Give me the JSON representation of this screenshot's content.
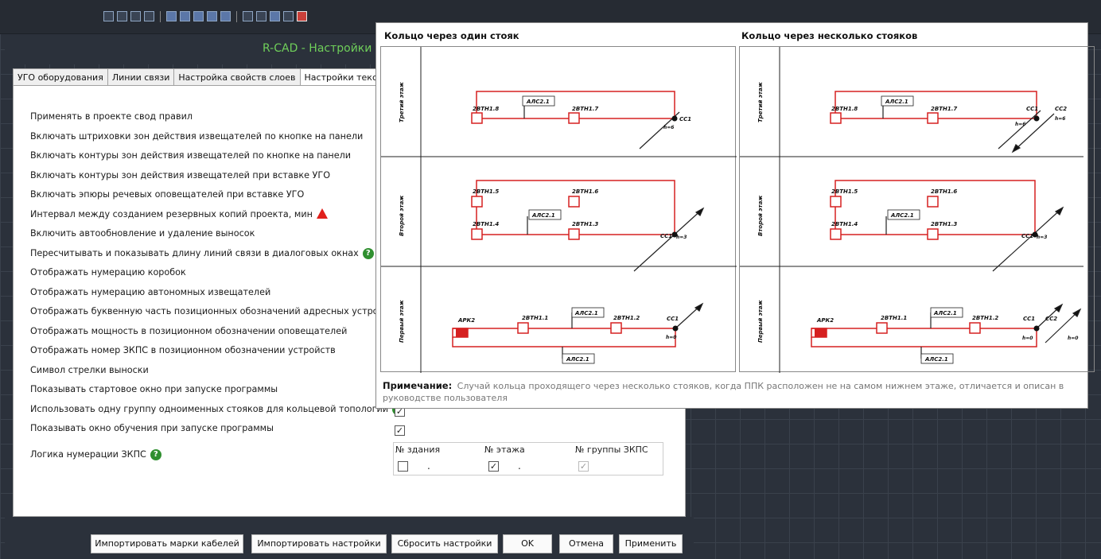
{
  "window": {
    "title": "R-CAD - Настройки"
  },
  "tabs": [
    {
      "label": "УГО оборудования"
    },
    {
      "label": "Линии связи"
    },
    {
      "label": "Настройка свойств слоев"
    },
    {
      "label": "Настройки текста"
    }
  ],
  "settings": [
    {
      "label": "Применять в проекте свод правил"
    },
    {
      "label": "Включать штриховки зон действия извещателей по кнопке на панели"
    },
    {
      "label": "Включать контуры зон действия извещателей по кнопке на панели"
    },
    {
      "label": "Включать контуры зон действия извещателей при вставке УГО"
    },
    {
      "label": "Включать эпюры речевых оповещателей при вставке УГО"
    },
    {
      "label": "Интервал между созданием резервных копий проекта, мин",
      "icon": "warning-icon"
    },
    {
      "label": "Включить автообновление и удаление  выносок"
    },
    {
      "label": "Пересчитывать и показывать  длину линий связи в диалоговых окнах",
      "icon": "help-icon"
    },
    {
      "label": "Отображать нумерацию коробок"
    },
    {
      "label": "Отображать нумерацию автономных извещателей"
    },
    {
      "label": "Отображать буквенную часть позиционных обозначений адресных устройств"
    },
    {
      "label": "Отображать мощность в позиционном обозначении оповещателей"
    },
    {
      "label": "Отображать номер ЗКПС в позиционном обозначении устройств"
    },
    {
      "label": "Символ стрелки выноски"
    },
    {
      "label": "Показывать стартовое окно при запуске программы"
    },
    {
      "label": "Использовать одну группу одноименных стояков для кольцевой топологии",
      "icon": "help-icon",
      "checked": true
    },
    {
      "label": "Показывать окно обучения при запуске программы",
      "checked": true
    },
    {
      "label": "Логика нумерации ЗКПС",
      "icon": "help-icon"
    }
  ],
  "zkps": {
    "building_label": "№ здания",
    "floor_label": "№ этажа",
    "group_label": "№ группы ЗКПС",
    "building_checked": false,
    "floor_checked": true,
    "group_checked": true,
    "separator": "."
  },
  "buttons": {
    "import_cables": "Импортировать марки кабелей",
    "import_settings": "Импортировать настройки",
    "reset": "Сбросить настройки",
    "ok": "OK",
    "cancel": "Отмена",
    "apply": "Применить"
  },
  "popup": {
    "left_title": "Кольцо через один стояк",
    "right_title": "Кольцо через несколько стояков",
    "note_label": "Примечание:",
    "note_text": "Случай кольца проходящего через несколько стояков, когда ППК расположен не на самом нижнем этаже, отличается и описан в руководстве пользователя",
    "left": {
      "floors": [
        "Третий этаж",
        "Второй этаж",
        "Первый этаж"
      ],
      "f3": {
        "d1": "2ВТН1.8",
        "d2": "2ВТН1.7",
        "als": "АЛС2.1",
        "riser": "СС1",
        "h": "h=6"
      },
      "f2": {
        "d1": "2ВТН1.5",
        "d2": "2ВТН1.6",
        "d3": "2ВТН1.4",
        "d4": "2ВТН1.3",
        "als": "АЛС2.1",
        "riser": "СС1",
        "h": "h=3"
      },
      "f1": {
        "ppk": "АРК2",
        "d1": "2ВТН1.1",
        "d2": "2ВТН1.2",
        "als": "АЛС2.1",
        "als2": "АЛС2.1",
        "riser": "СС1",
        "h": "h=0"
      }
    },
    "right": {
      "floors": [
        "Третий этаж",
        "Второй этаж",
        "Первый этаж"
      ],
      "f3": {
        "d1": "2ВТН1.8",
        "d2": "2ВТН1.7",
        "als": "АЛС2.1",
        "riser": "СС1",
        "riser2": "СС2",
        "h": "h=6",
        "h2": "h=6"
      },
      "f2": {
        "d1": "2ВТН1.5",
        "d2": "2ВТН1.6",
        "d3": "2ВТН1.4",
        "d4": "2ВТН1.3",
        "als": "АЛС2.1",
        "riser": "СС1",
        "h": "h=3"
      },
      "f1": {
        "ppk": "АРК2",
        "d1": "2ВТН1.1",
        "d2": "2ВТН1.2",
        "als": "АЛС2.1",
        "als2": "АЛС2.1",
        "riser": "СС1",
        "riser2": "СС2",
        "h": "h=0",
        "h2": "h=0"
      }
    }
  }
}
